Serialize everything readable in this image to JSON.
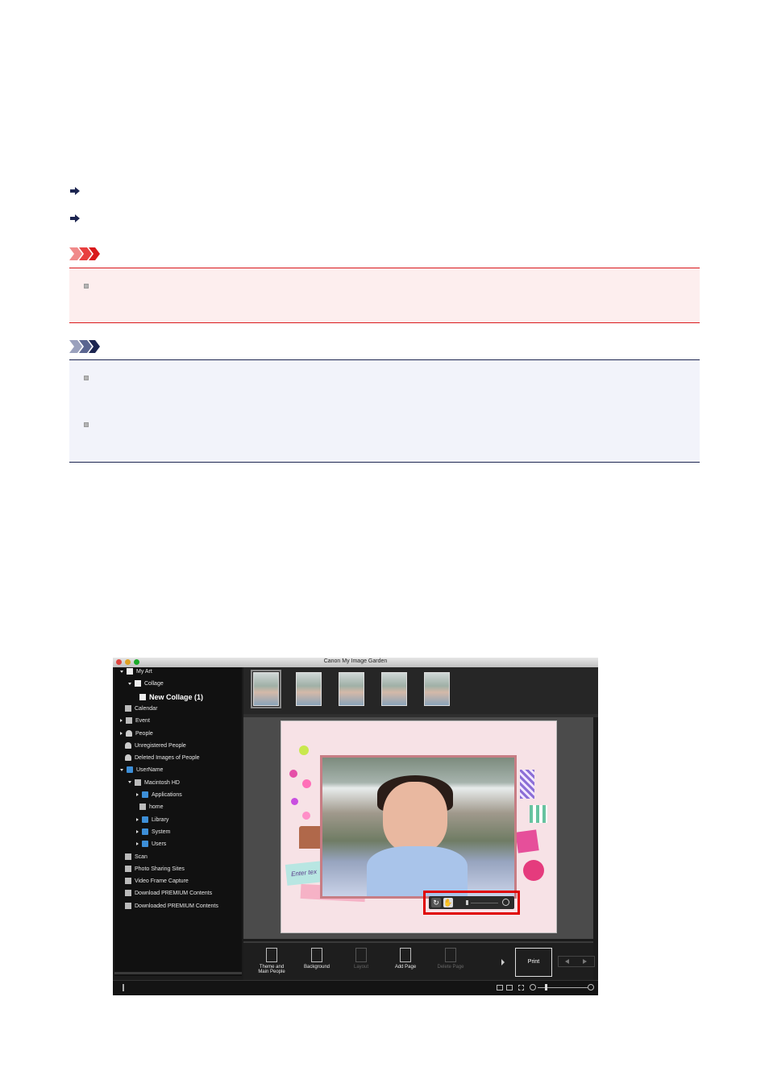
{
  "document": {
    "important_badge": "important-badge",
    "note_badge": "note-badge"
  },
  "app": {
    "window_title": "Canon My Image Garden",
    "sidebar": {
      "items": [
        {
          "label": "My Art",
          "expand": "open"
        },
        {
          "label": "Collage",
          "expand": "open"
        },
        {
          "label": "New Collage (1)",
          "expand": "none"
        },
        {
          "label": "Calendar",
          "expand": "none"
        },
        {
          "label": "Event",
          "expand": "closed"
        },
        {
          "label": "People",
          "expand": "closed"
        },
        {
          "label": "Unregistered People",
          "expand": "none"
        },
        {
          "label": "Deleted Images of People",
          "expand": "none"
        },
        {
          "label": "UserName",
          "expand": "open"
        },
        {
          "label": "Macintosh HD",
          "expand": "open"
        },
        {
          "label": "Applications",
          "expand": "closed"
        },
        {
          "label": "home",
          "expand": "none"
        },
        {
          "label": "Library",
          "expand": "closed"
        },
        {
          "label": "System",
          "expand": "closed"
        },
        {
          "label": "Users",
          "expand": "closed"
        },
        {
          "label": "Scan",
          "expand": "none"
        },
        {
          "label": "Photo Sharing Sites",
          "expand": "none"
        },
        {
          "label": "Video Frame Capture",
          "expand": "none"
        },
        {
          "label": "Download PREMIUM Contents",
          "expand": "none"
        },
        {
          "label": "Downloaded PREMIUM Contents",
          "expand": "none"
        }
      ]
    },
    "canvas": {
      "enter_text": "Enter tex"
    },
    "toolbar": {
      "theme_line1": "Theme and",
      "theme_line2": "Main People",
      "background": "Background",
      "layout": "Layout",
      "add_page": "Add Page",
      "delete_page": "Delete Page",
      "print": "Print"
    },
    "colors": {
      "highlight": "#e00000",
      "folder": "#3d8fd8"
    }
  }
}
